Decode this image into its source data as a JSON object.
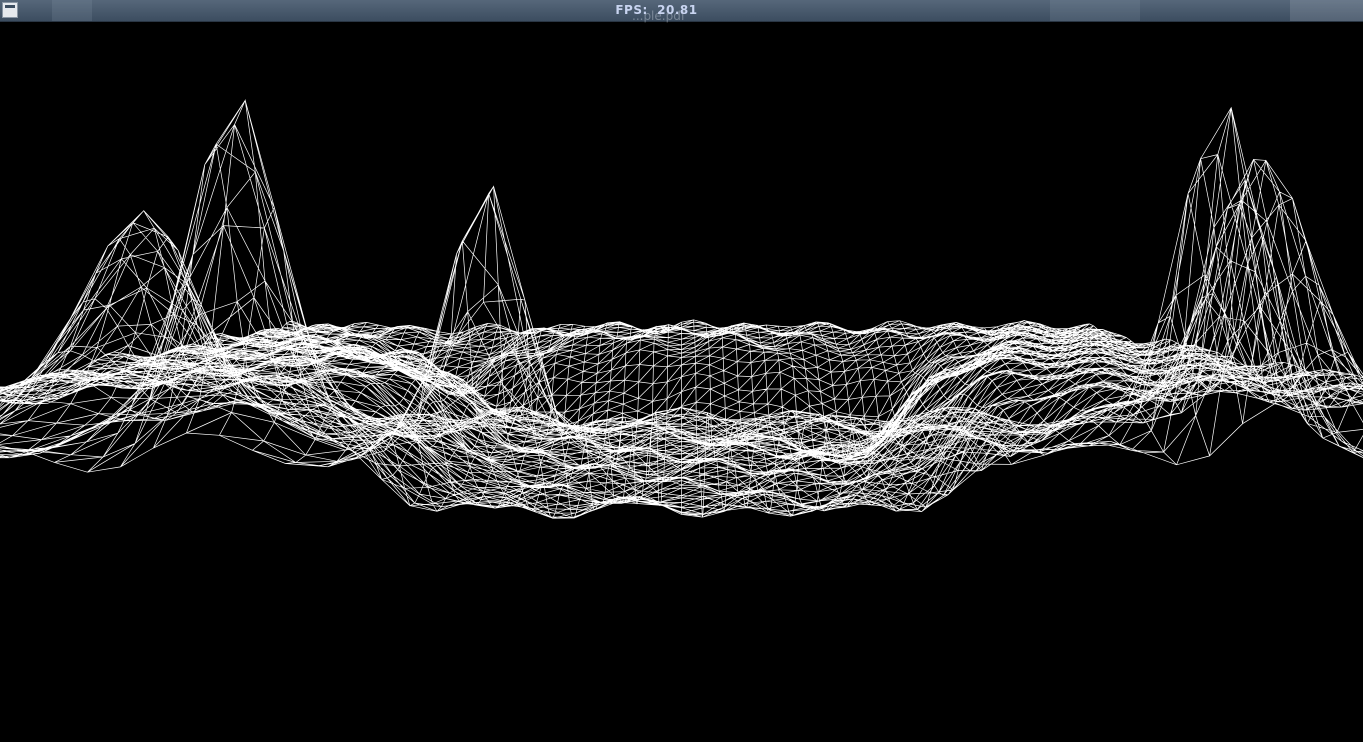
{
  "window": {
    "fps_label": "FPS:",
    "fps_value": "20.81",
    "background_title": "...ple.pdf"
  },
  "render": {
    "mode": "wireframe",
    "line_color": "#ffffff",
    "background_color": "#000000"
  },
  "colors": {
    "titlebar_top": "#56677a",
    "titlebar_bottom": "#3c4d60",
    "title_text": "#c8d4f0"
  }
}
